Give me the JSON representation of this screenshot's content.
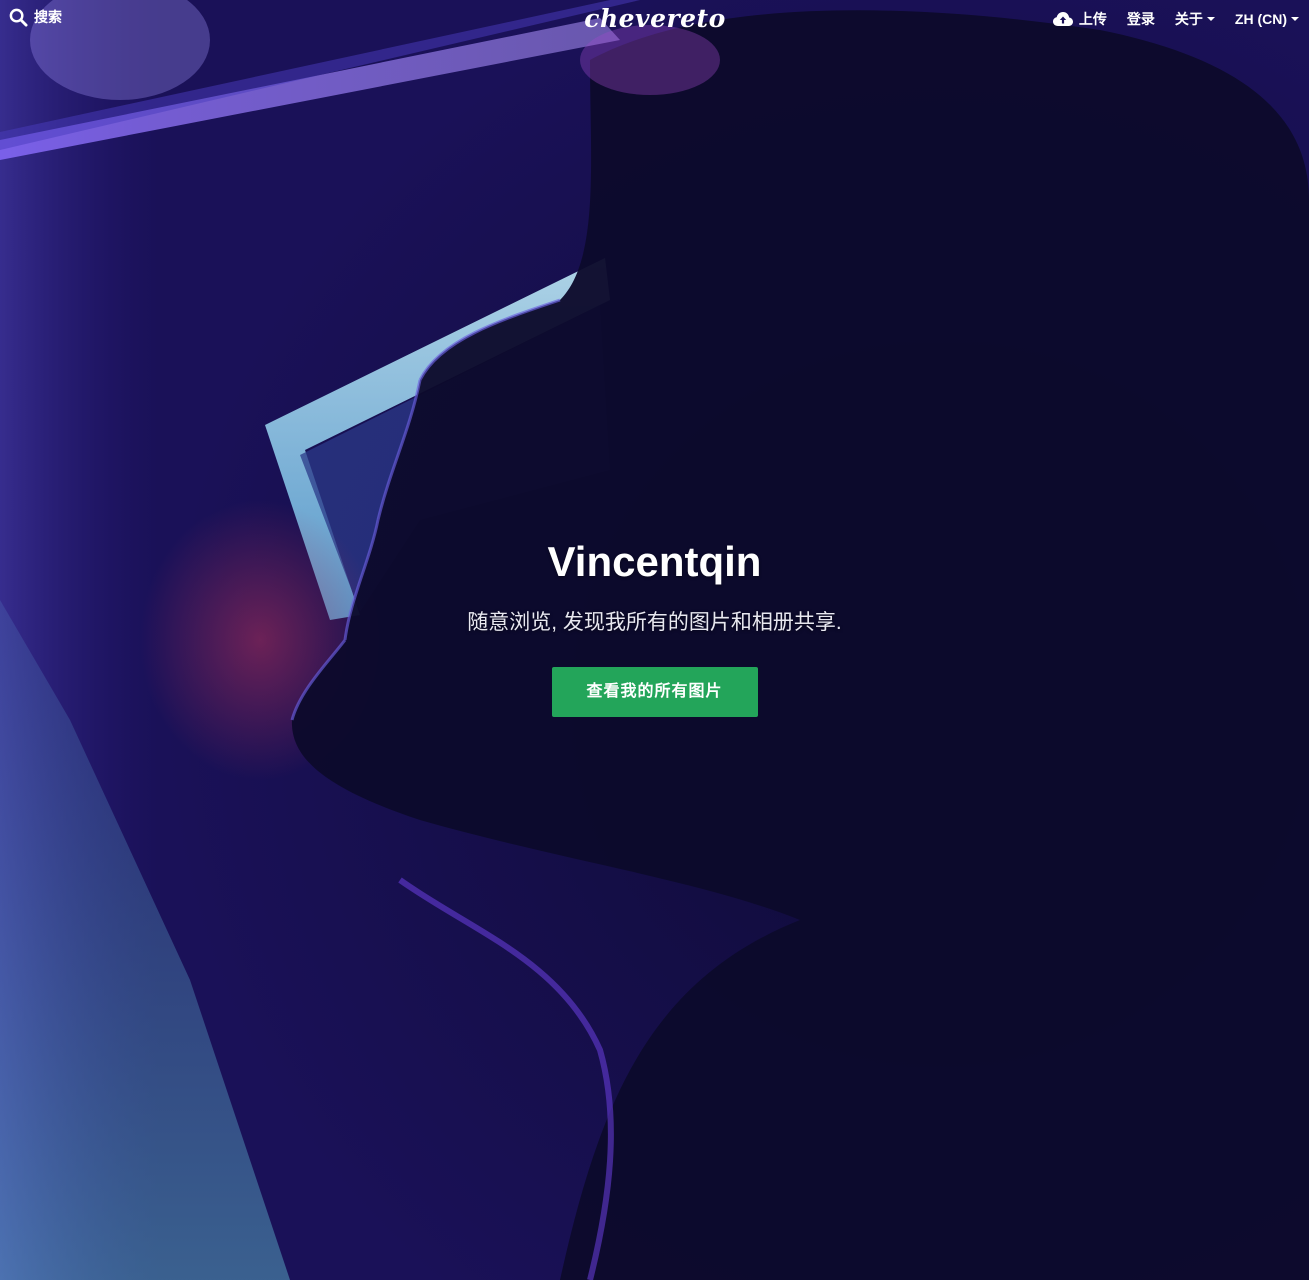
{
  "header": {
    "search_label": "搜索",
    "logo_text": "chevereto",
    "upload_label": "上传",
    "login_label": "登录",
    "about_label": "关于",
    "language_label": "ZH (CN)"
  },
  "hero": {
    "title": "Vincentqin",
    "subtitle": "随意浏览, 发现我所有的图片和相册共享.",
    "button_label": "查看我的所有图片"
  },
  "colors": {
    "button_green": "#23a55a",
    "background_purple": "#1c1260"
  },
  "icons": {
    "search": "search-icon",
    "upload": "cloud-upload-icon",
    "dropdown": "caret-down-icon"
  }
}
